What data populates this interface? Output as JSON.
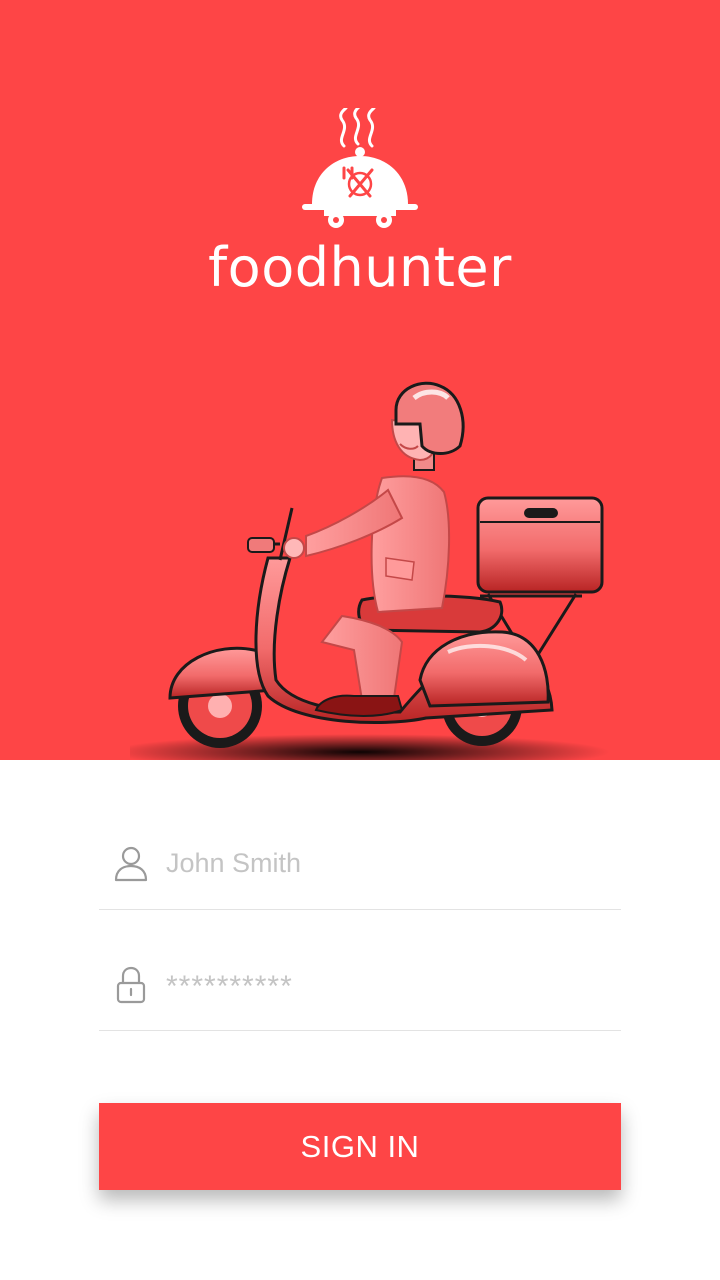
{
  "brand": {
    "name": "foodhunter",
    "logo_icon": "covered-dish-icon"
  },
  "illustration": {
    "subject": "delivery-scooter-icon"
  },
  "login": {
    "username": {
      "icon": "user-icon",
      "placeholder": "John Smith",
      "value": ""
    },
    "password": {
      "icon": "lock-icon",
      "placeholder": "**********",
      "value": ""
    },
    "submit_label": "SIGN IN"
  },
  "colors": {
    "primary": "#fe4546",
    "background": "#ffffff",
    "placeholder": "#c4c4c4",
    "divider": "#e3e3e3"
  }
}
